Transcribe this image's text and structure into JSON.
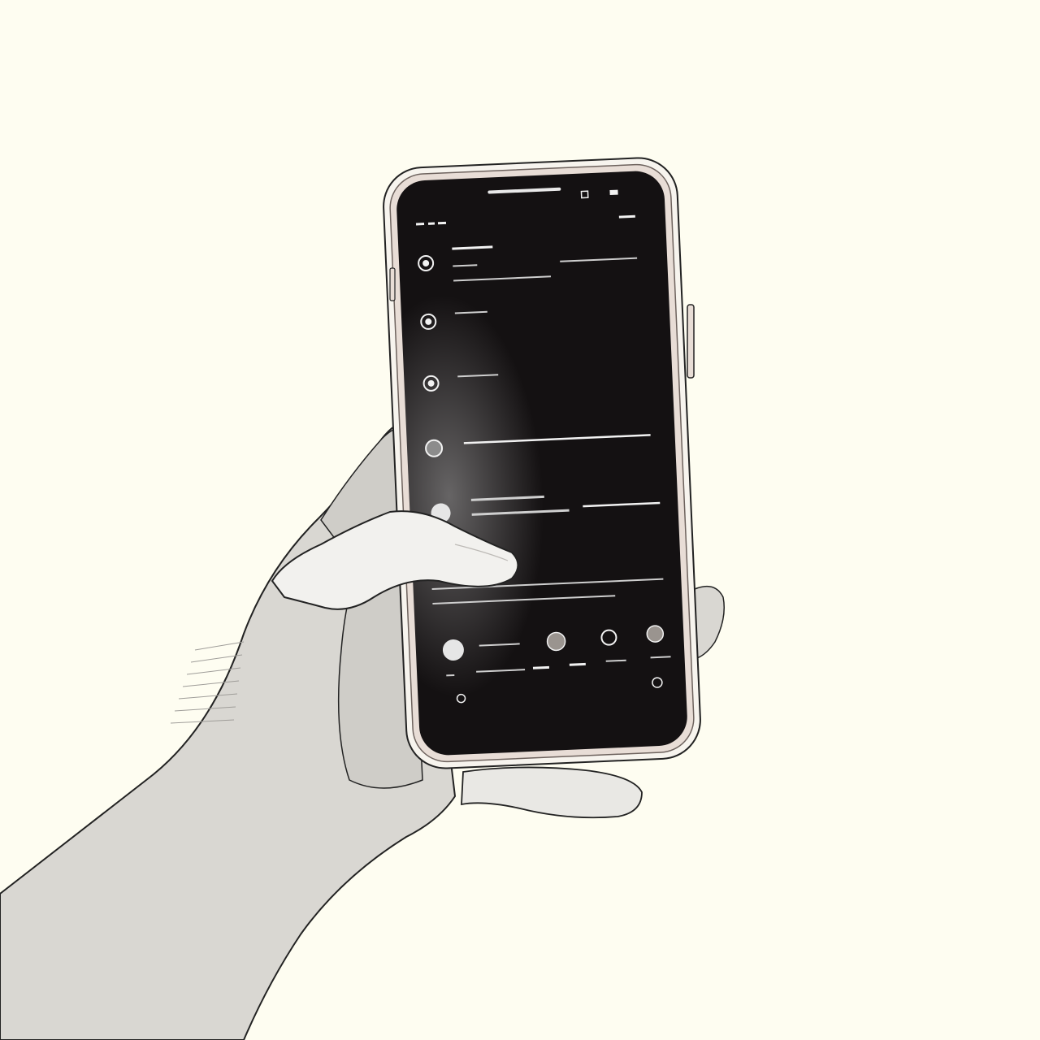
{
  "scene": {
    "description_hidden": "",
    "colors": {
      "background": "#fefdf1",
      "skin": "#d9d7d2",
      "skin_highlight": "#f2f1ee",
      "skin_shadow": "#b9b7b3",
      "outline": "#222222",
      "phone_frame": "#e8ddd6",
      "phone_screen": "#141112",
      "screen_ink": "#f2f2f2"
    },
    "icons": [
      "radio-icon",
      "radio-icon",
      "radio-icon",
      "radio-icon",
      "radio-icon",
      "dot-icon",
      "dot-icon",
      "dot-icon",
      "dot-icon",
      "dot-icon",
      "dot-icon"
    ]
  }
}
